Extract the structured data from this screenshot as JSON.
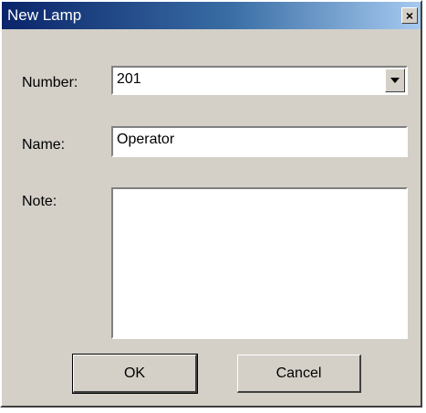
{
  "window": {
    "title": "New Lamp",
    "close_glyph": "×"
  },
  "form": {
    "number_label": "Number:",
    "number_value": "201",
    "name_label": "Name:",
    "name_value": "Operator",
    "note_label": "Note:",
    "note_value": ""
  },
  "buttons": {
    "ok_label": "OK",
    "cancel_label": "Cancel"
  },
  "icons": {
    "dropdown": "chevron-down-icon",
    "close": "close-icon"
  },
  "colors": {
    "dialog_bg": "#d4d0c8",
    "title_start": "#0a246a",
    "title_end": "#a6caf0"
  }
}
